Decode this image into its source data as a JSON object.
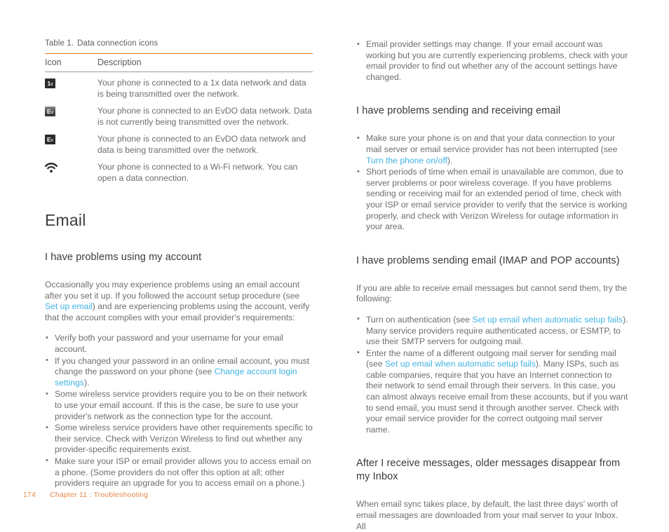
{
  "page": {
    "footer": {
      "page_number": "174",
      "chapter": "Chapter 11",
      "separator": ":",
      "section": "Troubleshooting"
    },
    "link_color": "#43b3e3",
    "rule_color": "#e8761a",
    "footer_color": "#e8884a"
  },
  "table": {
    "caption_number": "Table 1.",
    "caption_text": "Data connection icons",
    "headers": {
      "icon": "Icon",
      "description": "Description"
    },
    "rows": [
      {
        "icon_name": "1x-data-icon",
        "icon_label_bold": "1",
        "icon_label_small": "x",
        "icon_style": "dark",
        "description": "Your phone is connected to a 1x data network and data is being transmitted over the network."
      },
      {
        "icon_name": "evdo-idle-icon",
        "icon_label_bold": "E",
        "icon_label_small": "v",
        "icon_style": "gradient",
        "description": "Your phone is connected to an EvDO data network. Data is not currently being transmitted over the network."
      },
      {
        "icon_name": "evdo-active-icon",
        "icon_label_bold": "E",
        "icon_label_small": "v",
        "icon_style": "dark",
        "description": "Your phone is connected to an EvDO data network and data is being transmitted over the network."
      },
      {
        "icon_name": "wifi-icon",
        "icon_label_bold": "",
        "icon_label_small": "",
        "icon_style": "wifi",
        "description": "Your phone is connected to a Wi-Fi network. You can open a data connection."
      }
    ]
  },
  "email_section": {
    "title": "Email",
    "account_problems": {
      "heading": "I have problems using my account",
      "intro_part1": "Occasionally you may experience problems using an email account after you set it up. If you followed the account setup procedure (see ",
      "intro_link": "Set up email",
      "intro_part2": ") and are experiencing problems using the account, verify that the account complies with your email provider's requirements:",
      "bullets": [
        {
          "part1": "Verify both your password and your username for your email account.",
          "link": "",
          "part2": ""
        },
        {
          "part1": "If you changed your password in an online email account, you must change the password on your phone (see ",
          "link": "Change account login settings",
          "part2": ")."
        },
        {
          "part1": "Some wireless service providers require you to be on their network to use your email account. If this is the case, be sure to use your provider's network as the connection type for the account.",
          "link": "",
          "part2": ""
        },
        {
          "part1": "Some wireless service providers have other requirements specific to their service. Check with Verizon Wireless to find out whether any provider-specific requirements exist.",
          "link": "",
          "part2": ""
        },
        {
          "part1": "Make sure your ISP or email provider allows you to access email on a phone. (Some providers do not offer this option at all; other providers require an upgrade for you to access email on a phone.)",
          "link": "",
          "part2": ""
        }
      ]
    },
    "continued_bullet": {
      "text": "Email provider settings may change. If your email account was working but you are currently experiencing problems, check with your email provider to find out whether any of the account settings have changed."
    },
    "sending_receiving": {
      "heading": "I have problems sending and receiving email",
      "bullets": [
        {
          "part1": "Make sure your phone is on and that your data connection to your mail server or email service provider has not been interrupted (see ",
          "link": "Turn the phone on/off",
          "part2": ")."
        },
        {
          "part1": "Short periods of time when email is unavailable are common, due to server problems or poor wireless coverage. If you have problems sending or receiving mail for an extended period of time, check with your ISP or email service provider to verify that the service is working properly, and check with Verizon Wireless for outage information in your area.",
          "link": "",
          "part2": ""
        }
      ]
    },
    "imap_pop": {
      "heading": "I have problems sending email (IMAP and POP accounts)",
      "intro": "If you are able to receive email messages but cannot send them, try the following:",
      "bullets": [
        {
          "part1": "Turn on authentication (see ",
          "link": "Set up email when automatic setup fails",
          "part2": "). Many service providers require authenticated access, or ESMTP, to use their SMTP servers for outgoing mail."
        },
        {
          "part1": "Enter the name of a different outgoing mail server for sending mail (see ",
          "link": "Set up email when automatic setup fails",
          "part2": "). Many ISPs, such as cable companies, require that you have an Internet connection to their network to send email through their servers. In this case, you can almost always receive email from these accounts, but if you want to send email, you must send it through another server. Check with your email service provider for the correct outgoing mail server name."
        }
      ]
    },
    "older_messages": {
      "heading": "After I receive messages, older messages disappear from my Inbox",
      "body": "When email sync takes place, by default, the last three days' worth of email messages are downloaded from your mail server to your Inbox. All"
    }
  }
}
